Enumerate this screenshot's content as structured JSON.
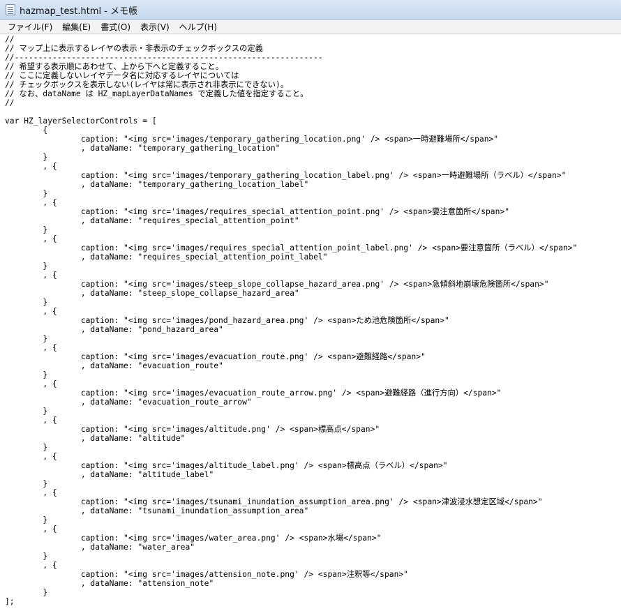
{
  "window": {
    "title": "hazmap_test.html - メモ帳"
  },
  "menu": {
    "items": [
      "ファイル(F)",
      "編集(E)",
      "書式(O)",
      "表示(V)",
      "ヘルプ(H)"
    ]
  },
  "editor": {
    "lines": [
      "//",
      "// マップ上に表示するレイヤの表示・非表示のチェックボックスの定義",
      "//-----------------------------------------------------------------",
      "// 希望する表示順にあわせて、上から下へと定義すること。",
      "// ここに定義しないレイヤデータ名に対応するレイヤについては",
      "// チェックボックスを表示しない(レイヤは常に表示され非表示にできない)。",
      "// なお、dataName は HZ_mapLayerDataNames で定義した値を指定すること。",
      "//",
      "",
      "var HZ_layerSelectorControls = [",
      "        {",
      "                caption: \"<img src='images/temporary_gathering_location.png' /> <span>一時避難場所</span>\"",
      "                , dataName: \"temporary_gathering_location\"",
      "        }",
      "        , {",
      "                caption: \"<img src='images/temporary_gathering_location_label.png' /> <span>一時避難場所（ラベル）</span>\"",
      "                , dataName: \"temporary_gathering_location_label\"",
      "        }",
      "        , {",
      "                caption: \"<img src='images/requires_special_attention_point.png' /> <span>要注意箇所</span>\"",
      "                , dataName: \"requires_special_attention_point\"",
      "        }",
      "        , {",
      "                caption: \"<img src='images/requires_special_attention_point_label.png' /> <span>要注意箇所（ラベル）</span>\"",
      "                , dataName: \"requires_special_attention_point_label\"",
      "        }",
      "        , {",
      "                caption: \"<img src='images/steep_slope_collapse_hazard_area.png' /> <span>急傾斜地崩壊危険箇所</span>\"",
      "                , dataName: \"steep_slope_collapse_hazard_area\"",
      "        }",
      "        , {",
      "                caption: \"<img src='images/pond_hazard_area.png' /> <span>ため池危険箇所</span>\"",
      "                , dataName: \"pond_hazard_area\"",
      "        }",
      "        , {",
      "                caption: \"<img src='images/evacuation_route.png' /> <span>避難経路</span>\"",
      "                , dataName: \"evacuation_route\"",
      "        }",
      "        , {",
      "                caption: \"<img src='images/evacuation_route_arrow.png' /> <span>避難経路（進行方向）</span>\"",
      "                , dataName: \"evacuation_route_arrow\"",
      "        }",
      "        , {",
      "                caption: \"<img src='images/altitude.png' /> <span>標高点</span>\"",
      "                , dataName: \"altitude\"",
      "        }",
      "        , {",
      "                caption: \"<img src='images/altitude_label.png' /> <span>標高点（ラベル）</span>\"",
      "                , dataName: \"altitude_label\"",
      "        }",
      "        , {",
      "                caption: \"<img src='images/tsunami_inundation_assumption_area.png' /> <span>津波浸水想定区域</span>\"",
      "                , dataName: \"tsunami_inundation_assumption_area\"",
      "        }",
      "        , {",
      "                caption: \"<img src='images/water_area.png' /> <span>水場</span>\"",
      "                , dataName: \"water_area\"",
      "        }",
      "        , {",
      "                caption: \"<img src='images/attension_note.png' /> <span>注釈等</span>\"",
      "                , dataName: \"attension_note\"",
      "        }",
      "];"
    ]
  }
}
